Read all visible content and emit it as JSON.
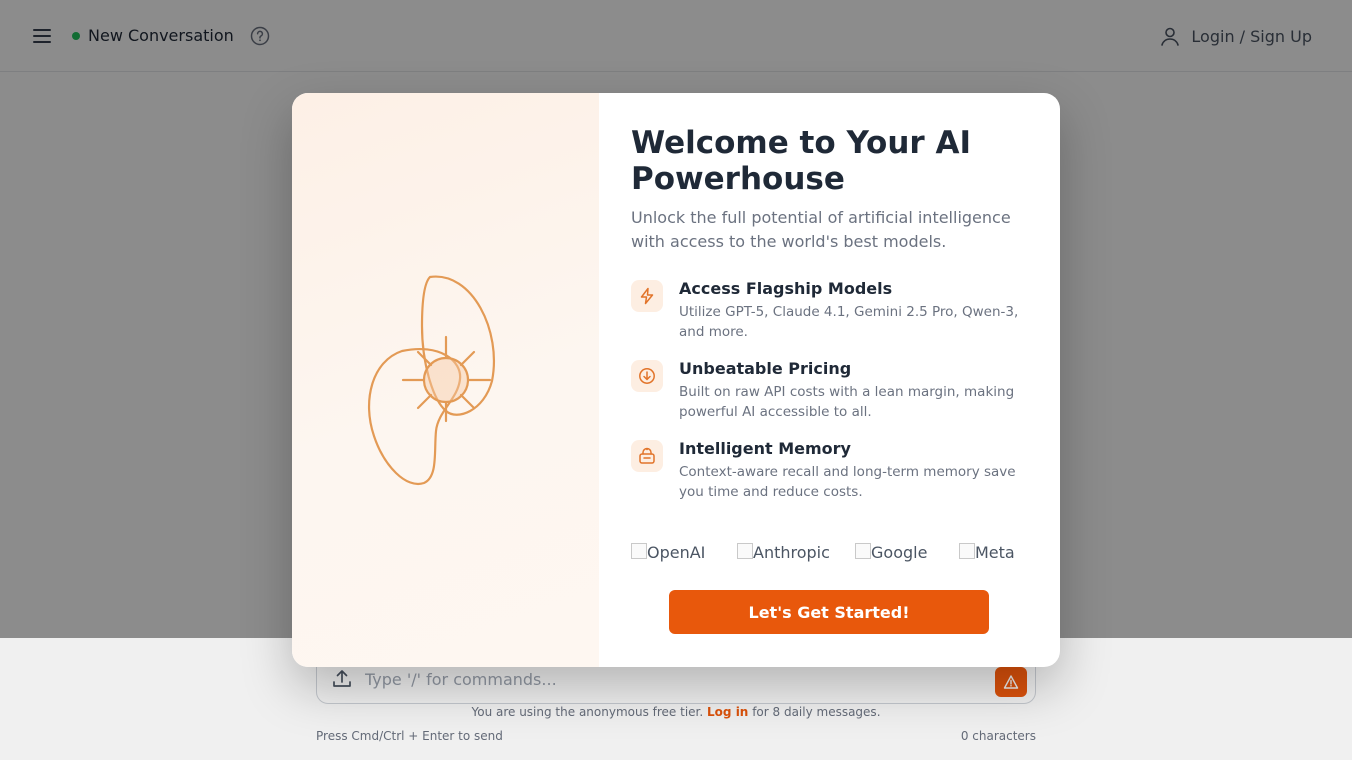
{
  "header": {
    "conversation_title": "New Conversation",
    "login_label": "Login / Sign Up"
  },
  "composer": {
    "placeholder": "Type '/' for commands...",
    "tier_prefix": "You are using the anonymous free tier.",
    "tier_link": "Log in",
    "tier_suffix": "for 8 daily messages.",
    "send_hint": "Press Cmd/Ctrl + Enter to send",
    "char_count": "0 characters"
  },
  "modal": {
    "title": "Welcome to Your AI Powerhouse",
    "subtitle": "Unlock the full potential of artificial intelligence with access to the world's best models.",
    "features": [
      {
        "icon": "lightning-icon",
        "title": "Access Flagship Models",
        "description": "Utilize GPT-5, Claude 4.1, Gemini 2.5 Pro, Qwen-3, and more."
      },
      {
        "icon": "down-arrow-circle-icon",
        "title": "Unbeatable Pricing",
        "description": "Built on raw API costs with a lean margin, making powerful AI accessible to all."
      },
      {
        "icon": "memory-box-icon",
        "title": "Intelligent Memory",
        "description": "Context-aware recall and long-term memory save you time and reduce costs."
      }
    ],
    "logos": [
      "OpenAI",
      "Anthropic",
      "Google",
      "Meta"
    ],
    "cta_label": "Let's Get Started!"
  },
  "colors": {
    "accent": "#ea580c",
    "status_online": "#22c55e",
    "art_stroke": "#e39a55"
  }
}
